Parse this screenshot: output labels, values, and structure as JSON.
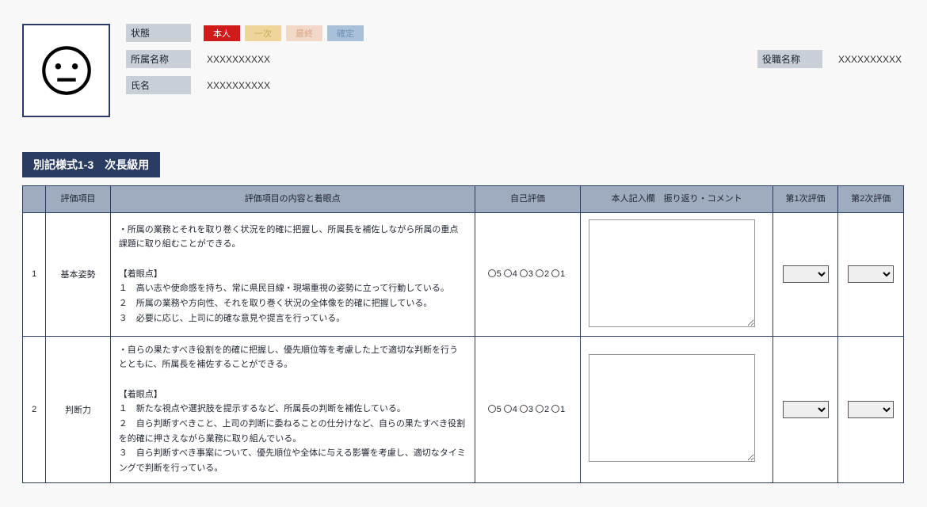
{
  "header": {
    "status_label": "状態",
    "badges": [
      "本人",
      "一次",
      "最終",
      "確定"
    ],
    "dept_label": "所属名称",
    "dept_val": "XXXXXXXXXX",
    "post_label": "役職名称",
    "post_val": "XXXXXXXXXX",
    "name_label": "氏名",
    "name_val": "XXXXXXXXXX"
  },
  "section_title": "別記様式1-3　次長級用",
  "th": {
    "num": " ",
    "item": "評価項目",
    "desc": "評価項目の内容と着眼点",
    "self": "自己評価",
    "comment": "本人記入欄　振り返り・コメント",
    "first": "第1次評価",
    "second": "第2次評価"
  },
  "rating_options": [
    "5",
    "4",
    "3",
    "2",
    "1"
  ],
  "rows": [
    {
      "n": "1",
      "item": "基本姿勢",
      "desc": "・所属の業務とそれを取り巻く状況を的確に把握し、所属長を補佐しながら所属の重点課題に取り組むことができる。\n\n【着眼点】\n１　高い志や使命感を持ち、常に県民目線・現場重視の姿勢に立って行動している。\n２　所属の業務や方向性、それを取り巻く状況の全体像を的確に把握している。\n３　必要に応じ、上司に的確な意見や提言を行っている。"
    },
    {
      "n": "2",
      "item": "判断力",
      "desc": "・自らの果たすべき役割を的確に把握し、優先順位等を考慮した上で適切な判断を行うとともに、所属長を補佐することができる。\n\n【着眼点】\n１　新たな視点や選択肢を提示するなど、所属長の判断を補佐している。\n２　自ら判断すべきこと、上司の判断に委ねることの仕分けなど、自らの果たすべき役割を的確に押さえながら業務に取り組んでいる。\n３　自ら判断すべき事案について、優先順位や全体に与える影響を考慮し、適切なタイミングで判断を行っている。"
    }
  ]
}
